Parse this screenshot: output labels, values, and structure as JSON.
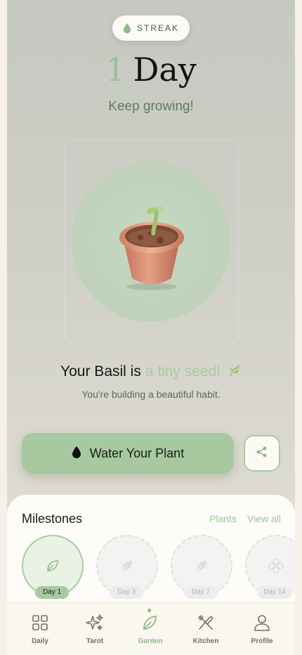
{
  "streak": {
    "label": "STREAK",
    "count": "1",
    "unit": "Day",
    "subtitle": "Keep growing!"
  },
  "plant": {
    "sentence_prefix": "Your Basil is",
    "stage": "a tiny seed!",
    "encouragement": "You're building a beautiful habit.",
    "image_icon": "seedling-in-pot"
  },
  "actions": {
    "water_label": "Water Your Plant",
    "water_icon": "water-drop-icon",
    "share_icon": "share-icon"
  },
  "milestones": {
    "title": "Milestones",
    "plants_link": "Plants",
    "view_all_link": "View all",
    "items": [
      {
        "label": "Day 1",
        "state": "active",
        "icon": "leaf-icon"
      },
      {
        "label": "Day 3",
        "state": "locked",
        "icon": "leaf-icon"
      },
      {
        "label": "Day 7",
        "state": "locked",
        "icon": "leaf-icon"
      },
      {
        "label": "Day 14",
        "state": "locked",
        "icon": "flower-icon"
      }
    ]
  },
  "tabs": [
    {
      "label": "Daily",
      "icon": "grid-icon",
      "active": false
    },
    {
      "label": "Tarot",
      "icon": "sparkles-icon",
      "active": false
    },
    {
      "label": "Garden",
      "icon": "leaf-icon",
      "active": true
    },
    {
      "label": "Kitchen",
      "icon": "utensils-icon",
      "active": false
    },
    {
      "label": "Profile",
      "icon": "user-icon",
      "active": false
    }
  ],
  "colors": {
    "accent": "#a6c99f",
    "accent_text": "#9dc497",
    "background": "#c8cbc3",
    "sheet": "#fdfcf8"
  }
}
